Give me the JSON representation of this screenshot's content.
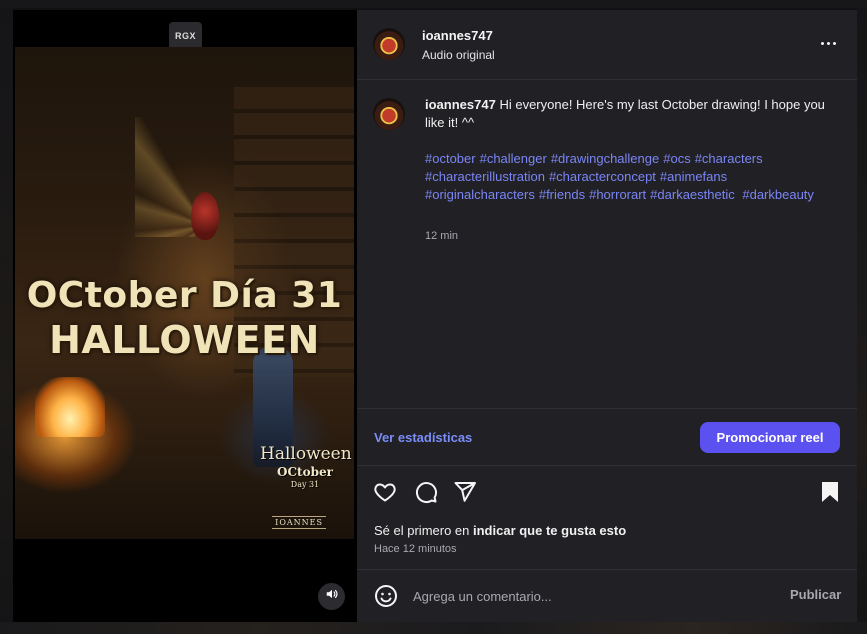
{
  "media": {
    "badge": "RGX",
    "art_title_line1": "OCtober Día 31",
    "art_title_line2": "HALLOWEEN",
    "art_sign_line1": "Halloween",
    "art_sign_line2": "OCtober",
    "art_sign_line3": "Day 31",
    "art_logo": "IOANNES"
  },
  "header": {
    "username": "ioannes747",
    "subtitle": "Audio original"
  },
  "caption": {
    "username": "ioannes747",
    "text": "Hi everyone! Here's my last October drawing! I hope you like it! ^^",
    "hashtags": [
      "#october",
      "#challenger",
      "#drawingchallenge",
      "#ocs",
      "#characters",
      "#characterillustration",
      "#characterconcept",
      "#animefans",
      "#originalcharacters",
      "#friends",
      "#horrorart",
      "#darkaesthetic",
      "#darkbeauty"
    ],
    "time": "12 min"
  },
  "stats": {
    "link_label": "Ver estadísticas",
    "promote_label": "Promocionar reel"
  },
  "actions": {
    "like_icon": "heart-icon",
    "comment_icon": "comment-icon",
    "share_icon": "send-icon",
    "save_icon": "bookmark-icon"
  },
  "likes": {
    "prefix": "Sé el primero en ",
    "bold": "indicar que te gusta esto",
    "ago": "Hace 12 minutos"
  },
  "comment": {
    "placeholder": "Agrega un comentario...",
    "publish_label": "Publicar"
  },
  "colors": {
    "panel_bg": "#202025",
    "accent": "#5b51f0",
    "link": "#7b86f5"
  }
}
